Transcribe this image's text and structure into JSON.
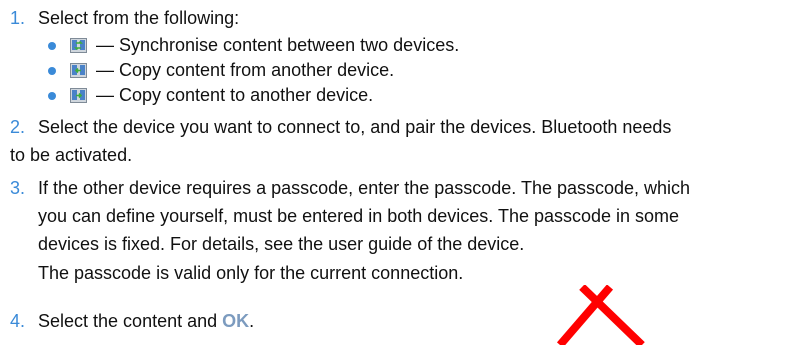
{
  "steps": [
    {
      "number": "1.",
      "text": "Select from the following:"
    },
    {
      "number": "2.",
      "lines": [
        "Select the device you want to connect to, and pair the devices. Bluetooth needs",
        "to be activated."
      ]
    },
    {
      "number": "3.",
      "lines": [
        "If the other device requires a passcode, enter the passcode. The passcode, which",
        "you can define yourself, must be entered in both devices. The passcode in some",
        "devices is fixed. For details, see the user guide of the device."
      ],
      "note": "The passcode is valid only for the current connection."
    },
    {
      "number": "4.",
      "text_before": "Select the content and ",
      "ok": "OK",
      "text_after": "."
    }
  ],
  "options": [
    {
      "icon": "sync-icon",
      "text": " — Synchronise content between two devices."
    },
    {
      "icon": "copy-from-icon",
      "text": " — Copy content from another device."
    },
    {
      "icon": "copy-to-icon",
      "text": " — Copy content to another device."
    }
  ],
  "colors": {
    "accent": "#3a8ad8",
    "ok": "#7c9bbf",
    "watermark": "#ff0000"
  }
}
